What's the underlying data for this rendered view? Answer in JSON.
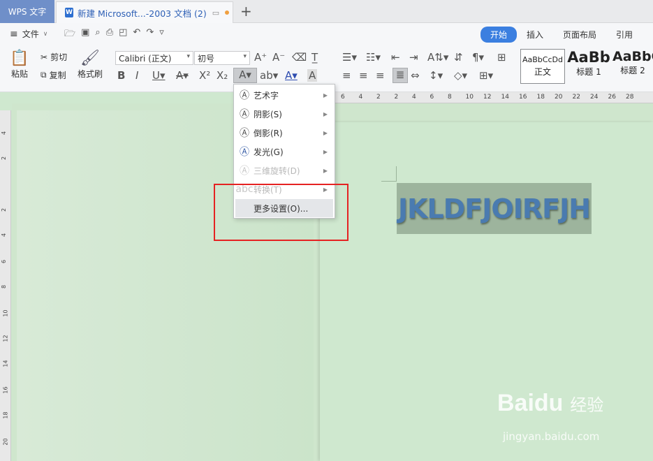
{
  "titlebar": {
    "app_tab": "WPS 文字",
    "doc_tab": "新建 Microsoft...-2003 文档 (2)",
    "new_tab": "+"
  },
  "menu": {
    "file": "文件",
    "tabs": [
      {
        "label": "开始",
        "active": true
      },
      {
        "label": "插入",
        "active": false
      },
      {
        "label": "页面布局",
        "active": false
      },
      {
        "label": "引用",
        "active": false
      }
    ]
  },
  "clipboard": {
    "paste": "粘贴",
    "cut": "剪切",
    "copy": "复制",
    "format_painter": "格式刷"
  },
  "font": {
    "name": "Calibri (正文)",
    "size": "初号"
  },
  "styles": [
    {
      "sample": "AaBbCcDd",
      "label": "正文"
    },
    {
      "sample": "AaBb",
      "label": "标题 1"
    },
    {
      "sample": "AaBbC",
      "label": "标题 2"
    }
  ],
  "ruler_top": [
    "6",
    "4",
    "2",
    "2",
    "4",
    "6",
    "8",
    "10",
    "12",
    "14",
    "16",
    "18",
    "20",
    "22",
    "24",
    "26",
    "28"
  ],
  "ruler_left": [
    "4",
    "2",
    "2",
    "4",
    "6",
    "8",
    "10",
    "12",
    "14",
    "16",
    "18",
    "20"
  ],
  "document": {
    "text": "JKLDFJOIRFJH"
  },
  "dropdown": {
    "items": [
      {
        "label": "艺术字",
        "disabled": false,
        "submenu": true
      },
      {
        "label": "阴影(S)",
        "disabled": false,
        "submenu": true
      },
      {
        "label": "倒影(R)",
        "disabled": false,
        "submenu": true
      },
      {
        "label": "发光(G)",
        "disabled": false,
        "submenu": true
      },
      {
        "label": "三维旋转(D)",
        "disabled": true,
        "submenu": true
      },
      {
        "label": "转换(T)",
        "disabled": true,
        "submenu": true
      },
      {
        "label": "更多设置(O)...",
        "disabled": false,
        "submenu": false
      }
    ]
  },
  "watermark": {
    "logo": "Baidu",
    "cn": "经验",
    "url": "jingyan.baidu.com"
  },
  "colors": {
    "accent": "#3b7fe0",
    "highlight_box": "#e52222",
    "page_bg": "#cfe8cf"
  }
}
